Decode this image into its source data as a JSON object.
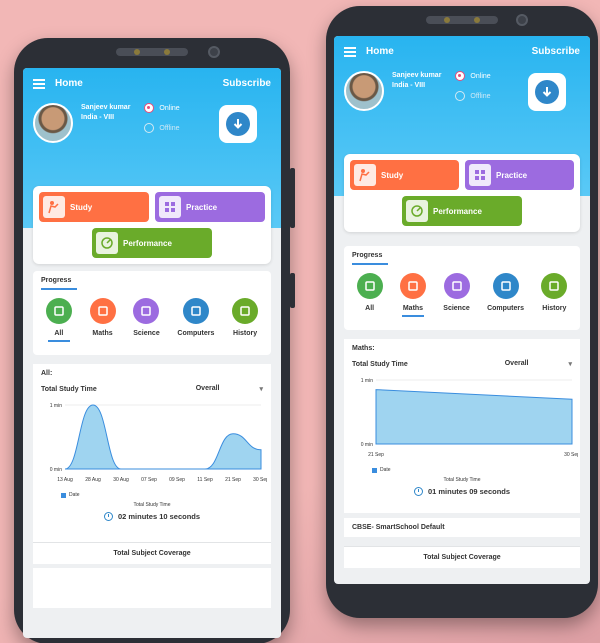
{
  "left_phone": {
    "nav": {
      "title": "Home",
      "subscribe": "Subscribe"
    },
    "user": {
      "name": "Sanjeev kumar",
      "class": "India - VIII"
    },
    "status": {
      "online": "Online",
      "offline": "Offline"
    },
    "actions": {
      "study": "Study",
      "practice": "Practice",
      "performance": "Performance"
    },
    "progress": {
      "title": "Progress",
      "subjects": [
        {
          "label": "All",
          "icon": "chart-icon",
          "color": "#4caf50"
        },
        {
          "label": "Maths",
          "icon": "calculator-icon",
          "color": "#ff7043"
        },
        {
          "label": "Science",
          "icon": "atom-icon",
          "color": "#9c6be0"
        },
        {
          "label": "Computers",
          "icon": "monitor-icon",
          "color": "#2f87c9"
        },
        {
          "label": "History",
          "icon": "history-icon",
          "color": "#6aab2a"
        }
      ],
      "selected": "All"
    },
    "chart_section": {
      "heading": "All:",
      "metric": "Total Study Time",
      "range": "Overall",
      "legend": "Date",
      "caption": "Total Study Time",
      "total": "02 minutes 10 seconds"
    },
    "coverage": "Total Subject Coverage"
  },
  "right_phone": {
    "nav": {
      "title": "Home",
      "subscribe": "Subscribe"
    },
    "user": {
      "name": "Sanjeev kumar",
      "class": "India - VIII"
    },
    "status": {
      "online": "Online",
      "offline": "Offline"
    },
    "actions": {
      "study": "Study",
      "practice": "Practice",
      "performance": "Performance"
    },
    "progress": {
      "title": "Progress",
      "subjects": [
        {
          "label": "All",
          "icon": "chart-icon",
          "color": "#4caf50"
        },
        {
          "label": "Maths",
          "icon": "calculator-icon",
          "color": "#ff7043"
        },
        {
          "label": "Science",
          "icon": "atom-icon",
          "color": "#9c6be0"
        },
        {
          "label": "Computers",
          "icon": "monitor-icon",
          "color": "#2f87c9"
        },
        {
          "label": "History",
          "icon": "history-icon",
          "color": "#6aab2a"
        }
      ],
      "selected": "Maths"
    },
    "chart_section": {
      "heading": "Maths:",
      "metric": "Total Study Time",
      "range": "Overall",
      "legend": "Date",
      "caption": "Total Study Time",
      "total": "01 minutes 09 seconds"
    },
    "board": "CBSE- SmartSchool Default",
    "coverage": "Total Subject Coverage"
  },
  "chart_data": [
    {
      "type": "area",
      "x": [
        "13 Aug",
        "28 Aug",
        "30 Aug",
        "07 Sep",
        "09 Sep",
        "11 Sep",
        "21 Sep",
        "30 Sep"
      ],
      "series": [
        {
          "values": [
            0,
            1,
            0,
            0,
            0,
            0,
            0.55,
            0.3
          ]
        }
      ],
      "ytick_labels": [
        "0 min",
        "1 min"
      ],
      "ylim": [
        0,
        1
      ],
      "color": "#3a8dde"
    },
    {
      "type": "area",
      "x": [
        "21 Sep",
        "30 Sep"
      ],
      "series": [
        {
          "values": [
            0.85,
            0.7
          ]
        }
      ],
      "ytick_labels": [
        "0 min",
        "1 min"
      ],
      "ylim": [
        0,
        1
      ],
      "color": "#3a8dde"
    }
  ],
  "colors": {
    "header": "#28b4f0",
    "study": "#ff7043",
    "practice": "#9c6be0",
    "performance": "#6aab2a",
    "accent": "#3a8dde"
  }
}
